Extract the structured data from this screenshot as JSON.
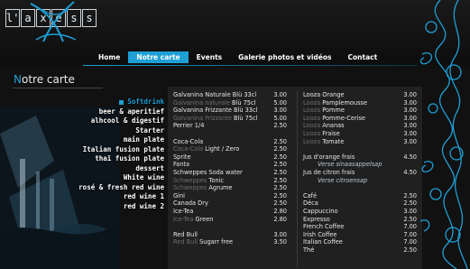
{
  "logo": {
    "letters": [
      "l'",
      "a",
      "x",
      "e",
      "s",
      "s"
    ]
  },
  "nav": [
    {
      "label": "Home",
      "active": false
    },
    {
      "label": "Notre carte",
      "active": true
    },
    {
      "label": "Events",
      "active": false
    },
    {
      "label": "Galerie photos et vidéos",
      "active": false
    },
    {
      "label": "Contact",
      "active": false
    }
  ],
  "title": {
    "first_letter": "N",
    "rest": "otre carte"
  },
  "categories": [
    {
      "label": "Softdrink",
      "active": true
    },
    {
      "label": "beer & aperitief",
      "active": false
    },
    {
      "label": "alhcool & digestif",
      "active": false
    },
    {
      "label": "Starter",
      "active": false
    },
    {
      "label": "main plate",
      "active": false
    },
    {
      "label": "Italian fusion plate",
      "active": false
    },
    {
      "label": "thaï fusion plate",
      "active": false
    },
    {
      "label": "dessert",
      "active": false
    },
    {
      "label": "White wine",
      "active": false
    },
    {
      "label": "rosé & fresh red wine",
      "active": false
    },
    {
      "label": "red wine 1",
      "active": false
    },
    {
      "label": "red wine 2",
      "active": false
    }
  ],
  "menu": {
    "left": [
      {
        "parts": [
          {
            "t": "Galvanina Naturale Blù 33cl",
            "dim": false
          }
        ],
        "price": "3.00"
      },
      {
        "parts": [
          {
            "t": "Galvanina naturale ",
            "dim": true
          },
          {
            "t": "Blù 75cl",
            "dim": false
          }
        ],
        "price": "5.00"
      },
      {
        "parts": [
          {
            "t": "Galvanina Frizzante Blù 33cl",
            "dim": false
          }
        ],
        "price": "3.00"
      },
      {
        "parts": [
          {
            "t": "Galvanina Frizzante ",
            "dim": true
          },
          {
            "t": "Blù 75cl",
            "dim": false
          }
        ],
        "price": "5.00"
      },
      {
        "parts": [
          {
            "t": "Perrier 1/4",
            "dim": false
          }
        ],
        "price": "2.50"
      },
      {
        "parts": [],
        "price": ""
      },
      {
        "parts": [
          {
            "t": "Coca-Cola",
            "dim": false
          }
        ],
        "price": "2.50"
      },
      {
        "parts": [
          {
            "t": "Coca-Cola ",
            "dim": true
          },
          {
            "t": "Light / Zero",
            "dim": false
          }
        ],
        "price": "2.50"
      },
      {
        "parts": [
          {
            "t": "Sprite",
            "dim": false
          }
        ],
        "price": "2.50"
      },
      {
        "parts": [
          {
            "t": "Fanta",
            "dim": false
          }
        ],
        "price": "2.50"
      },
      {
        "parts": [
          {
            "t": "Schweppes Soda water",
            "dim": false
          }
        ],
        "price": "2.50"
      },
      {
        "parts": [
          {
            "t": "Schweppes ",
            "dim": true
          },
          {
            "t": "Tonic",
            "dim": false
          }
        ],
        "price": "2.50"
      },
      {
        "parts": [
          {
            "t": "Schweppes ",
            "dim": true
          },
          {
            "t": "Agrume",
            "dim": false
          }
        ],
        "price": "2.50"
      },
      {
        "parts": [
          {
            "t": "Gini",
            "dim": false
          }
        ],
        "price": "2.50"
      },
      {
        "parts": [
          {
            "t": "Canada Dry",
            "dim": false
          }
        ],
        "price": "2.50"
      },
      {
        "parts": [
          {
            "t": "Ice-Tea",
            "dim": false
          }
        ],
        "price": "2.80"
      },
      {
        "parts": [
          {
            "t": "Ice-Tea ",
            "dim": true
          },
          {
            "t": "Green",
            "dim": false
          }
        ],
        "price": "2.80"
      },
      {
        "parts": [],
        "price": ""
      },
      {
        "parts": [
          {
            "t": "Red Bull",
            "dim": false
          }
        ],
        "price": "3.00"
      },
      {
        "parts": [
          {
            "t": "Red Bull ",
            "dim": true
          },
          {
            "t": "Sugarr free",
            "dim": false
          }
        ],
        "price": "3.50"
      }
    ],
    "right": [
      {
        "parts": [
          {
            "t": "Looza Orange",
            "dim": false
          }
        ],
        "price": "3.00"
      },
      {
        "parts": [
          {
            "t": "Looza ",
            "dim": true
          },
          {
            "t": "Pamplemousse",
            "dim": false
          }
        ],
        "price": "3.00"
      },
      {
        "parts": [
          {
            "t": "Looza ",
            "dim": true
          },
          {
            "t": "Pomme",
            "dim": false
          }
        ],
        "price": "3.00"
      },
      {
        "parts": [
          {
            "t": "Looza ",
            "dim": true
          },
          {
            "t": "Pomme-Cerise",
            "dim": false
          }
        ],
        "price": "3.00"
      },
      {
        "parts": [
          {
            "t": "Looza ",
            "dim": true
          },
          {
            "t": "Ananas",
            "dim": false
          }
        ],
        "price": "3.00"
      },
      {
        "parts": [
          {
            "t": "Looza ",
            "dim": true
          },
          {
            "t": "Fraise",
            "dim": false
          }
        ],
        "price": "3.00"
      },
      {
        "parts": [
          {
            "t": "Looza ",
            "dim": true
          },
          {
            "t": "Tomate",
            "dim": false
          }
        ],
        "price": "3.00"
      },
      {
        "parts": [],
        "price": ""
      },
      {
        "parts": [
          {
            "t": "Jus d'orange frais",
            "dim": false
          }
        ],
        "price": "4.50"
      },
      {
        "parts": [
          {
            "t": "Verse sinaasappelsap",
            "dim": false
          }
        ],
        "price": "",
        "sub": true
      },
      {
        "parts": [
          {
            "t": "Jus de citron frais",
            "dim": false
          }
        ],
        "price": "4.50"
      },
      {
        "parts": [
          {
            "t": "Verse citroensap",
            "dim": false
          }
        ],
        "price": "",
        "sub": true
      },
      {
        "parts": [],
        "price": ""
      },
      {
        "parts": [
          {
            "t": "Café",
            "dim": false
          }
        ],
        "price": "2.50"
      },
      {
        "parts": [
          {
            "t": "Déca",
            "dim": false
          }
        ],
        "price": "2.50"
      },
      {
        "parts": [
          {
            "t": "Cappuccino",
            "dim": false
          }
        ],
        "price": "3.00"
      },
      {
        "parts": [
          {
            "t": "Expresso",
            "dim": false
          }
        ],
        "price": "2.50"
      },
      {
        "parts": [
          {
            "t": "French Coffee",
            "dim": false
          }
        ],
        "price": "7.00"
      },
      {
        "parts": [
          {
            "t": "Irish Coffee",
            "dim": false
          }
        ],
        "price": "7.00"
      },
      {
        "parts": [
          {
            "t": "Italian Coffee",
            "dim": false
          }
        ],
        "price": "7.00"
      },
      {
        "parts": [
          {
            "t": "Thé",
            "dim": false
          }
        ],
        "price": "2.50"
      }
    ]
  },
  "colors": {
    "accent": "#1e9fd6",
    "background": "#111111",
    "panel": "#202020",
    "dim_text": "#6e6e6e"
  }
}
